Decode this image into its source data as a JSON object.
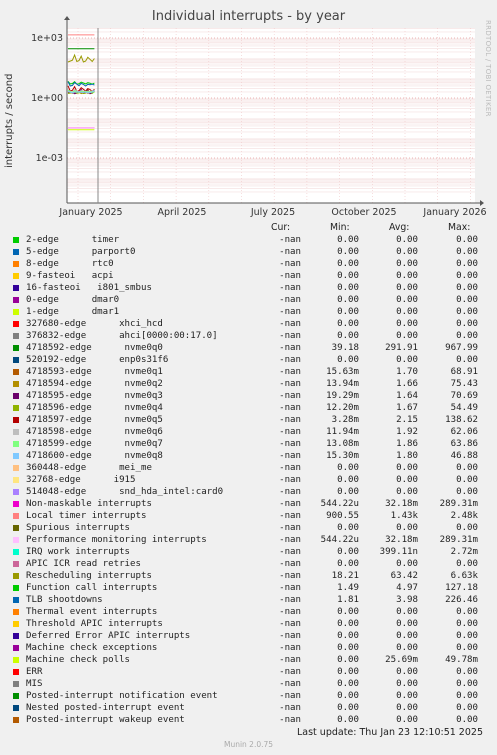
{
  "chart_data": {
    "type": "line",
    "title": "Individual interrupts - by year",
    "ylabel": "interrupts / second",
    "yscale": "log",
    "y_ticks": [
      "1e+03",
      "1e+00",
      "1e-03"
    ],
    "x_ticks": [
      "January 2025",
      "April 2025",
      "July 2025",
      "October 2025",
      "January 2026"
    ],
    "side_label": "RRDTOOL / TOBI OETIKER",
    "grid": true,
    "columns": [
      "Cur:",
      "Min:",
      "Avg:",
      "Max:"
    ],
    "series": [
      {
        "name": "2-edge      timer",
        "color": "#00cc00",
        "cur": "-nan",
        "min": "0.00",
        "avg": "0.00",
        "max": "0.00"
      },
      {
        "name": "5-edge      parport0",
        "color": "#0066b3",
        "cur": "-nan",
        "min": "0.00",
        "avg": "0.00",
        "max": "0.00"
      },
      {
        "name": "8-edge      rtc0",
        "color": "#ff8000",
        "cur": "-nan",
        "min": "0.00",
        "avg": "0.00",
        "max": "0.00"
      },
      {
        "name": "9-fasteoi   acpi",
        "color": "#ffcc00",
        "cur": "-nan",
        "min": "0.00",
        "avg": "0.00",
        "max": "0.00"
      },
      {
        "name": "16-fasteoi   i801_smbus",
        "color": "#330099",
        "cur": "-nan",
        "min": "0.00",
        "avg": "0.00",
        "max": "0.00"
      },
      {
        "name": "0-edge      dmar0",
        "color": "#990099",
        "cur": "-nan",
        "min": "0.00",
        "avg": "0.00",
        "max": "0.00"
      },
      {
        "name": "1-edge      dmar1",
        "color": "#ccff00",
        "cur": "-nan",
        "min": "0.00",
        "avg": "0.00",
        "max": "0.00"
      },
      {
        "name": "327680-edge      xhci_hcd",
        "color": "#ff0000",
        "cur": "-nan",
        "min": "0.00",
        "avg": "0.00",
        "max": "0.00"
      },
      {
        "name": "376832-edge      ahci[0000:00:17.0]",
        "color": "#808080",
        "cur": "-nan",
        "min": "0.00",
        "avg": "0.00",
        "max": "0.00"
      },
      {
        "name": "4718592-edge      nvme0q0",
        "color": "#008f00",
        "cur": "-nan",
        "min": "39.18",
        "avg": "291.91",
        "max": "967.99"
      },
      {
        "name": "520192-edge      enp0s31f6",
        "color": "#00487d",
        "cur": "-nan",
        "min": "0.00",
        "avg": "0.00",
        "max": "0.00"
      },
      {
        "name": "4718593-edge      nvme0q1",
        "color": "#b35a00",
        "cur": "-nan",
        "min": "15.63m",
        "avg": "1.70",
        "max": "68.91"
      },
      {
        "name": "4718594-edge      nvme0q2",
        "color": "#b38f00",
        "cur": "-nan",
        "min": "13.94m",
        "avg": "1.66",
        "max": "75.43"
      },
      {
        "name": "4718595-edge      nvme0q3",
        "color": "#6b006b",
        "cur": "-nan",
        "min": "19.29m",
        "avg": "1.64",
        "max": "70.69"
      },
      {
        "name": "4718596-edge      nvme0q4",
        "color": "#8fb300",
        "cur": "-nan",
        "min": "12.20m",
        "avg": "1.67",
        "max": "54.49"
      },
      {
        "name": "4718597-edge      nvme0q5",
        "color": "#b30000",
        "cur": "-nan",
        "min": "3.28m",
        "avg": "2.15",
        "max": "138.62"
      },
      {
        "name": "4718598-edge      nvme0q6",
        "color": "#bebebe",
        "cur": "-nan",
        "min": "11.94m",
        "avg": "1.92",
        "max": "62.06"
      },
      {
        "name": "4718599-edge      nvme0q7",
        "color": "#80ff80",
        "cur": "-nan",
        "min": "13.08m",
        "avg": "1.86",
        "max": "63.86"
      },
      {
        "name": "4718600-edge      nvme0q8",
        "color": "#80c9ff",
        "cur": "-nan",
        "min": "15.30m",
        "avg": "1.80",
        "max": "46.88"
      },
      {
        "name": "360448-edge      mei_me",
        "color": "#ffc080",
        "cur": "-nan",
        "min": "0.00",
        "avg": "0.00",
        "max": "0.00"
      },
      {
        "name": "32768-edge      i915",
        "color": "#ffe680",
        "cur": "-nan",
        "min": "0.00",
        "avg": "0.00",
        "max": "0.00"
      },
      {
        "name": "514048-edge      snd_hda_intel:card0",
        "color": "#aa80ff",
        "cur": "-nan",
        "min": "0.00",
        "avg": "0.00",
        "max": "0.00"
      },
      {
        "name": "Non-maskable interrupts",
        "color": "#ee00cc",
        "cur": "-nan",
        "min": "544.22u",
        "avg": "32.18m",
        "max": "289.31m"
      },
      {
        "name": "Local timer interrupts",
        "color": "#ff8080",
        "cur": "-nan",
        "min": "900.55",
        "avg": "1.43k",
        "max": "2.48k"
      },
      {
        "name": "Spurious interrupts",
        "color": "#666600",
        "cur": "-nan",
        "min": "0.00",
        "avg": "0.00",
        "max": "0.00"
      },
      {
        "name": "Performance monitoring interrupts",
        "color": "#ffbfff",
        "cur": "-nan",
        "min": "544.22u",
        "avg": "32.18m",
        "max": "289.31m"
      },
      {
        "name": "IRQ work interrupts",
        "color": "#00ffcc",
        "cur": "-nan",
        "min": "0.00",
        "avg": "399.11n",
        "max": "2.72m"
      },
      {
        "name": "APIC ICR read retries",
        "color": "#cc6699",
        "cur": "-nan",
        "min": "0.00",
        "avg": "0.00",
        "max": "0.00"
      },
      {
        "name": "Rescheduling interrupts",
        "color": "#999900",
        "cur": "-nan",
        "min": "18.21",
        "avg": "63.42",
        "max": "6.63k"
      },
      {
        "name": "Function call interrupts",
        "color": "#00cc00",
        "cur": "-nan",
        "min": "1.49",
        "avg": "4.97",
        "max": "127.18"
      },
      {
        "name": "TLB shootdowns",
        "color": "#0066b3",
        "cur": "-nan",
        "min": "1.81",
        "avg": "3.98",
        "max": "226.46"
      },
      {
        "name": "Thermal event interrupts",
        "color": "#ff8000",
        "cur": "-nan",
        "min": "0.00",
        "avg": "0.00",
        "max": "0.00"
      },
      {
        "name": "Threshold APIC interrupts",
        "color": "#ffcc00",
        "cur": "-nan",
        "min": "0.00",
        "avg": "0.00",
        "max": "0.00"
      },
      {
        "name": "Deferred Error APIC interrupts",
        "color": "#330099",
        "cur": "-nan",
        "min": "0.00",
        "avg": "0.00",
        "max": "0.00"
      },
      {
        "name": "Machine check exceptions",
        "color": "#990099",
        "cur": "-nan",
        "min": "0.00",
        "avg": "0.00",
        "max": "0.00"
      },
      {
        "name": "Machine check polls",
        "color": "#ccff00",
        "cur": "-nan",
        "min": "0.00",
        "avg": "25.69m",
        "max": "49.78m"
      },
      {
        "name": "ERR",
        "color": "#ff0000",
        "cur": "-nan",
        "min": "0.00",
        "avg": "0.00",
        "max": "0.00"
      },
      {
        "name": "MIS",
        "color": "#808080",
        "cur": "-nan",
        "min": "0.00",
        "avg": "0.00",
        "max": "0.00"
      },
      {
        "name": "Posted-interrupt notification event",
        "color": "#008f00",
        "cur": "-nan",
        "min": "0.00",
        "avg": "0.00",
        "max": "0.00"
      },
      {
        "name": "Nested posted-interrupt event",
        "color": "#00487d",
        "cur": "-nan",
        "min": "0.00",
        "avg": "0.00",
        "max": "0.00"
      },
      {
        "name": "Posted-interrupt wakeup event",
        "color": "#b35a00",
        "cur": "-nan",
        "min": "0.00",
        "avg": "0.00",
        "max": "0.00"
      }
    ]
  },
  "footer": {
    "last_update": "Last update: Thu Jan 23 12:10:51 2025",
    "munin": "Munin 2.0.75"
  }
}
